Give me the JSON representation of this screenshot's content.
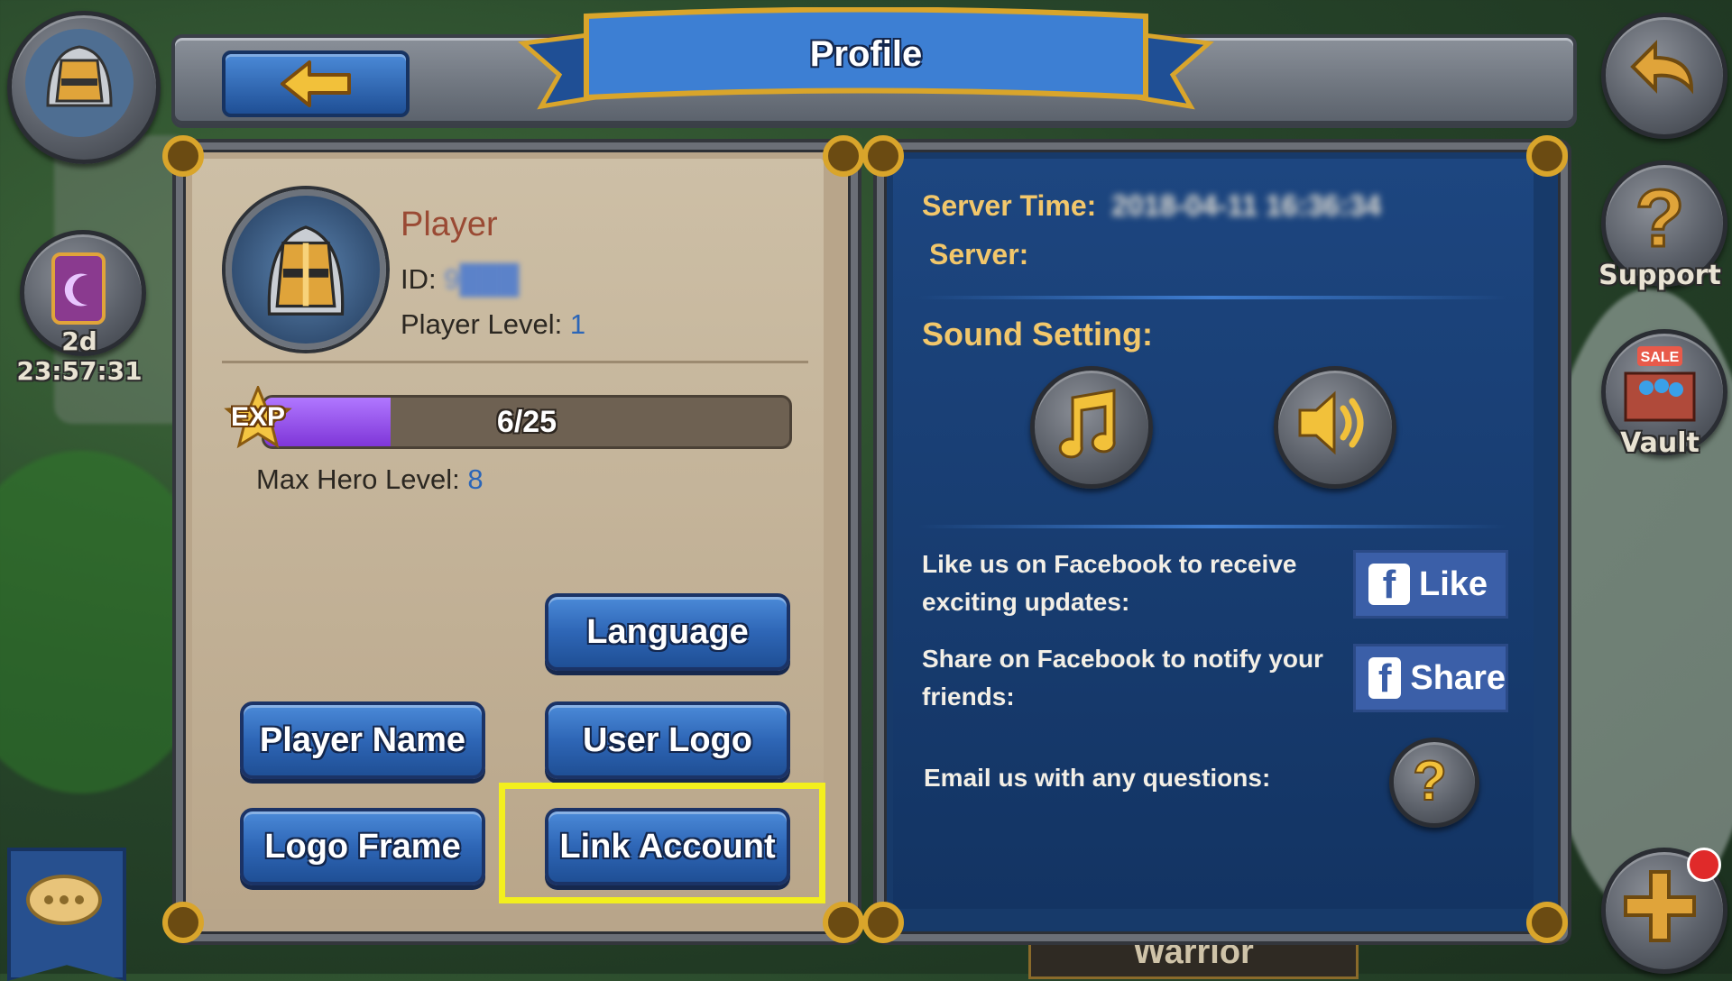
{
  "header": {
    "title": "Profile"
  },
  "left_hud": {
    "timer": "2d 23:57:31"
  },
  "right_hud": {
    "support_label": "Support",
    "vault_label": "Vault",
    "sale_tag": "SALE"
  },
  "background_text": {
    "warrior": "Warrior"
  },
  "profile": {
    "name": "Player",
    "id_label": "ID:",
    "id_value": "9███",
    "level_label": "Player Level:",
    "level_value": "1",
    "exp_badge": "EXP",
    "exp_text": "6/25",
    "exp_progress": 0.24,
    "max_hero_label": "Max Hero Level:",
    "max_hero_value": "8"
  },
  "buttons": {
    "language": "Language",
    "player_name": "Player Name",
    "user_logo": "User Logo",
    "logo_frame": "Logo Frame",
    "link_account": "Link Account"
  },
  "settings": {
    "server_time_label": "Server Time:",
    "server_time_value": "2018-04-11 16:36:34",
    "server_label": "Server:",
    "sound_setting_label": "Sound Setting:",
    "facebook_like_text": "Like us on Facebook to receive exciting updates:",
    "facebook_like_button": "Like",
    "facebook_share_text": "Share on Facebook to notify your friends:",
    "facebook_share_button": "Share",
    "email_text": "Email us with any questions:"
  },
  "colors": {
    "accent_blue": "#2e66b6",
    "exp_purple": "#9a4de8",
    "gold": "#f2c76b",
    "highlight": "#f3ef1e"
  }
}
